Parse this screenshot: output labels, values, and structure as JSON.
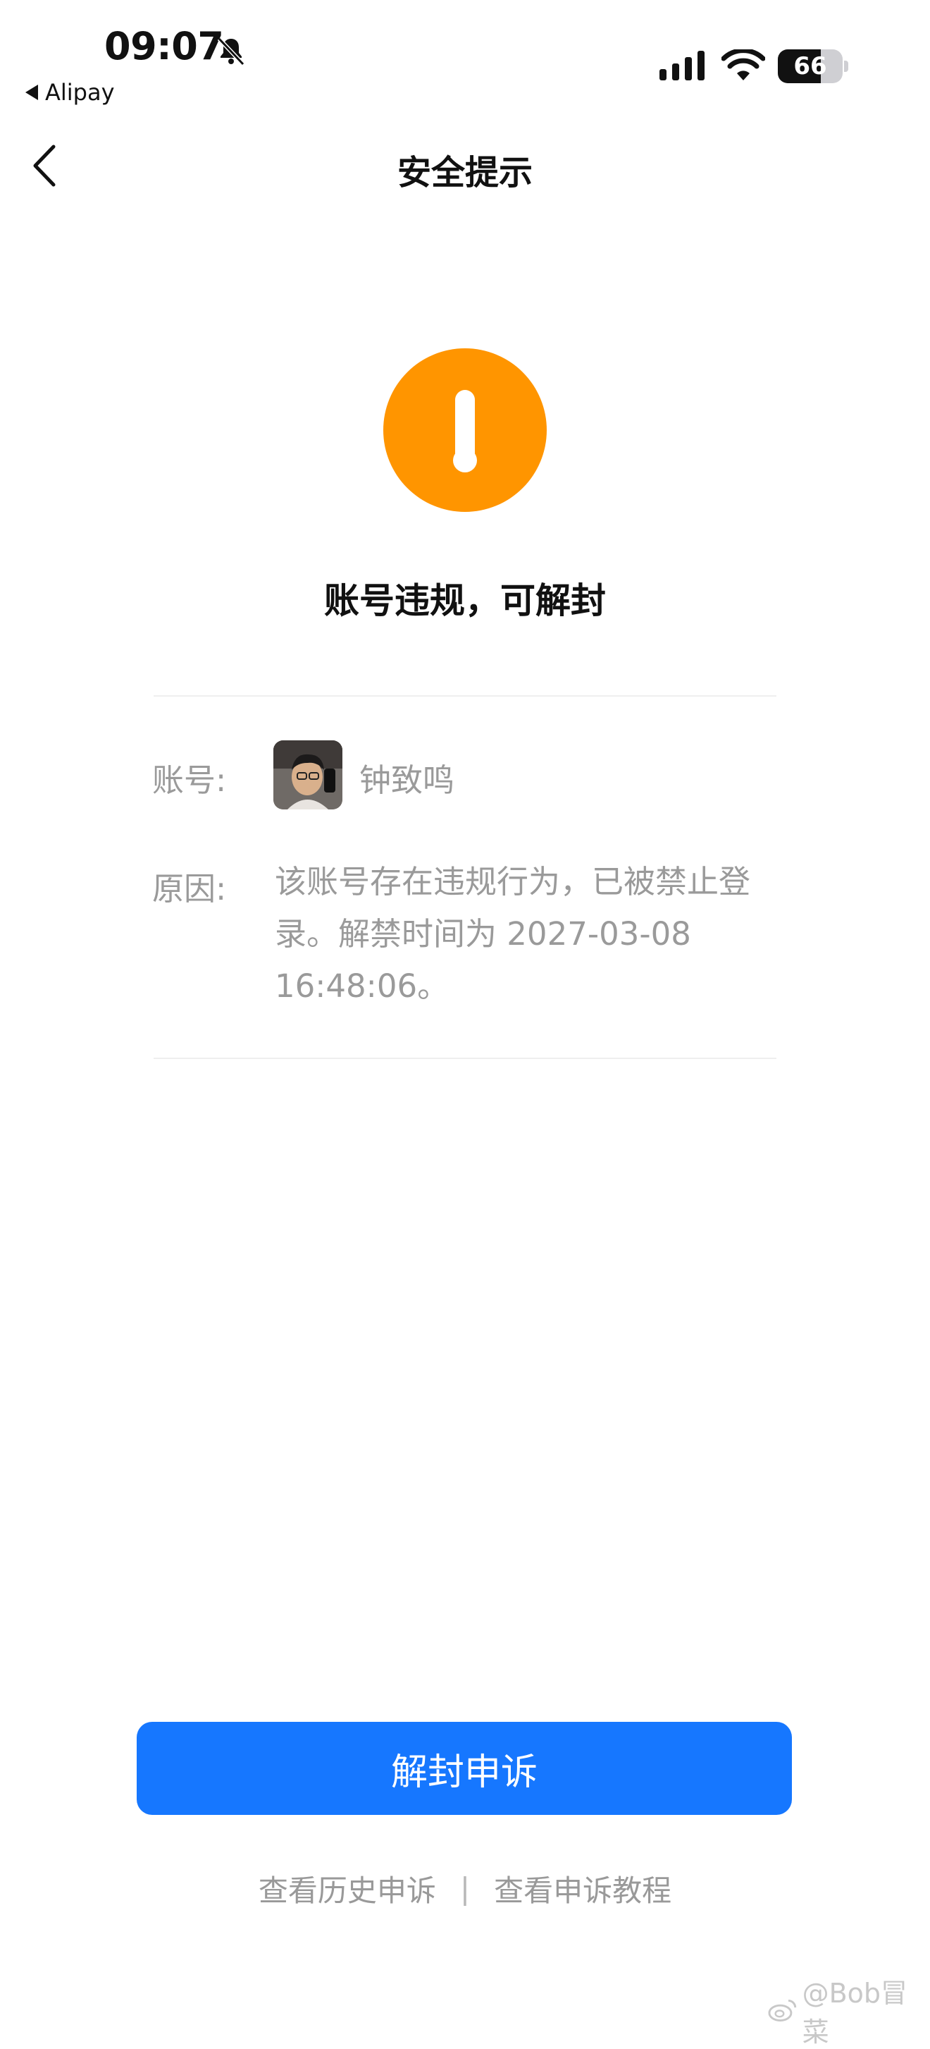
{
  "status_bar": {
    "time": "09:07",
    "back_app": "Alipay",
    "battery_level": "66"
  },
  "nav": {
    "title": "安全提示"
  },
  "notice": {
    "headline": "账号违规，可解封",
    "account_label": "账号:",
    "account_name": "钟致鸣",
    "reason_label": "原因:",
    "reason_text": "该账号存在违规行为，已被禁止登录。解禁时间为 2027-03-08 16:48:06。"
  },
  "actions": {
    "appeal_button": "解封申诉",
    "history_link": "查看历史申诉",
    "separator": "|",
    "tutorial_link": "查看申诉教程"
  },
  "watermark": "@Bob冒菜",
  "colors": {
    "accent": "#1677ff",
    "warning": "#ff9500",
    "muted_text": "#9a9a9a"
  }
}
